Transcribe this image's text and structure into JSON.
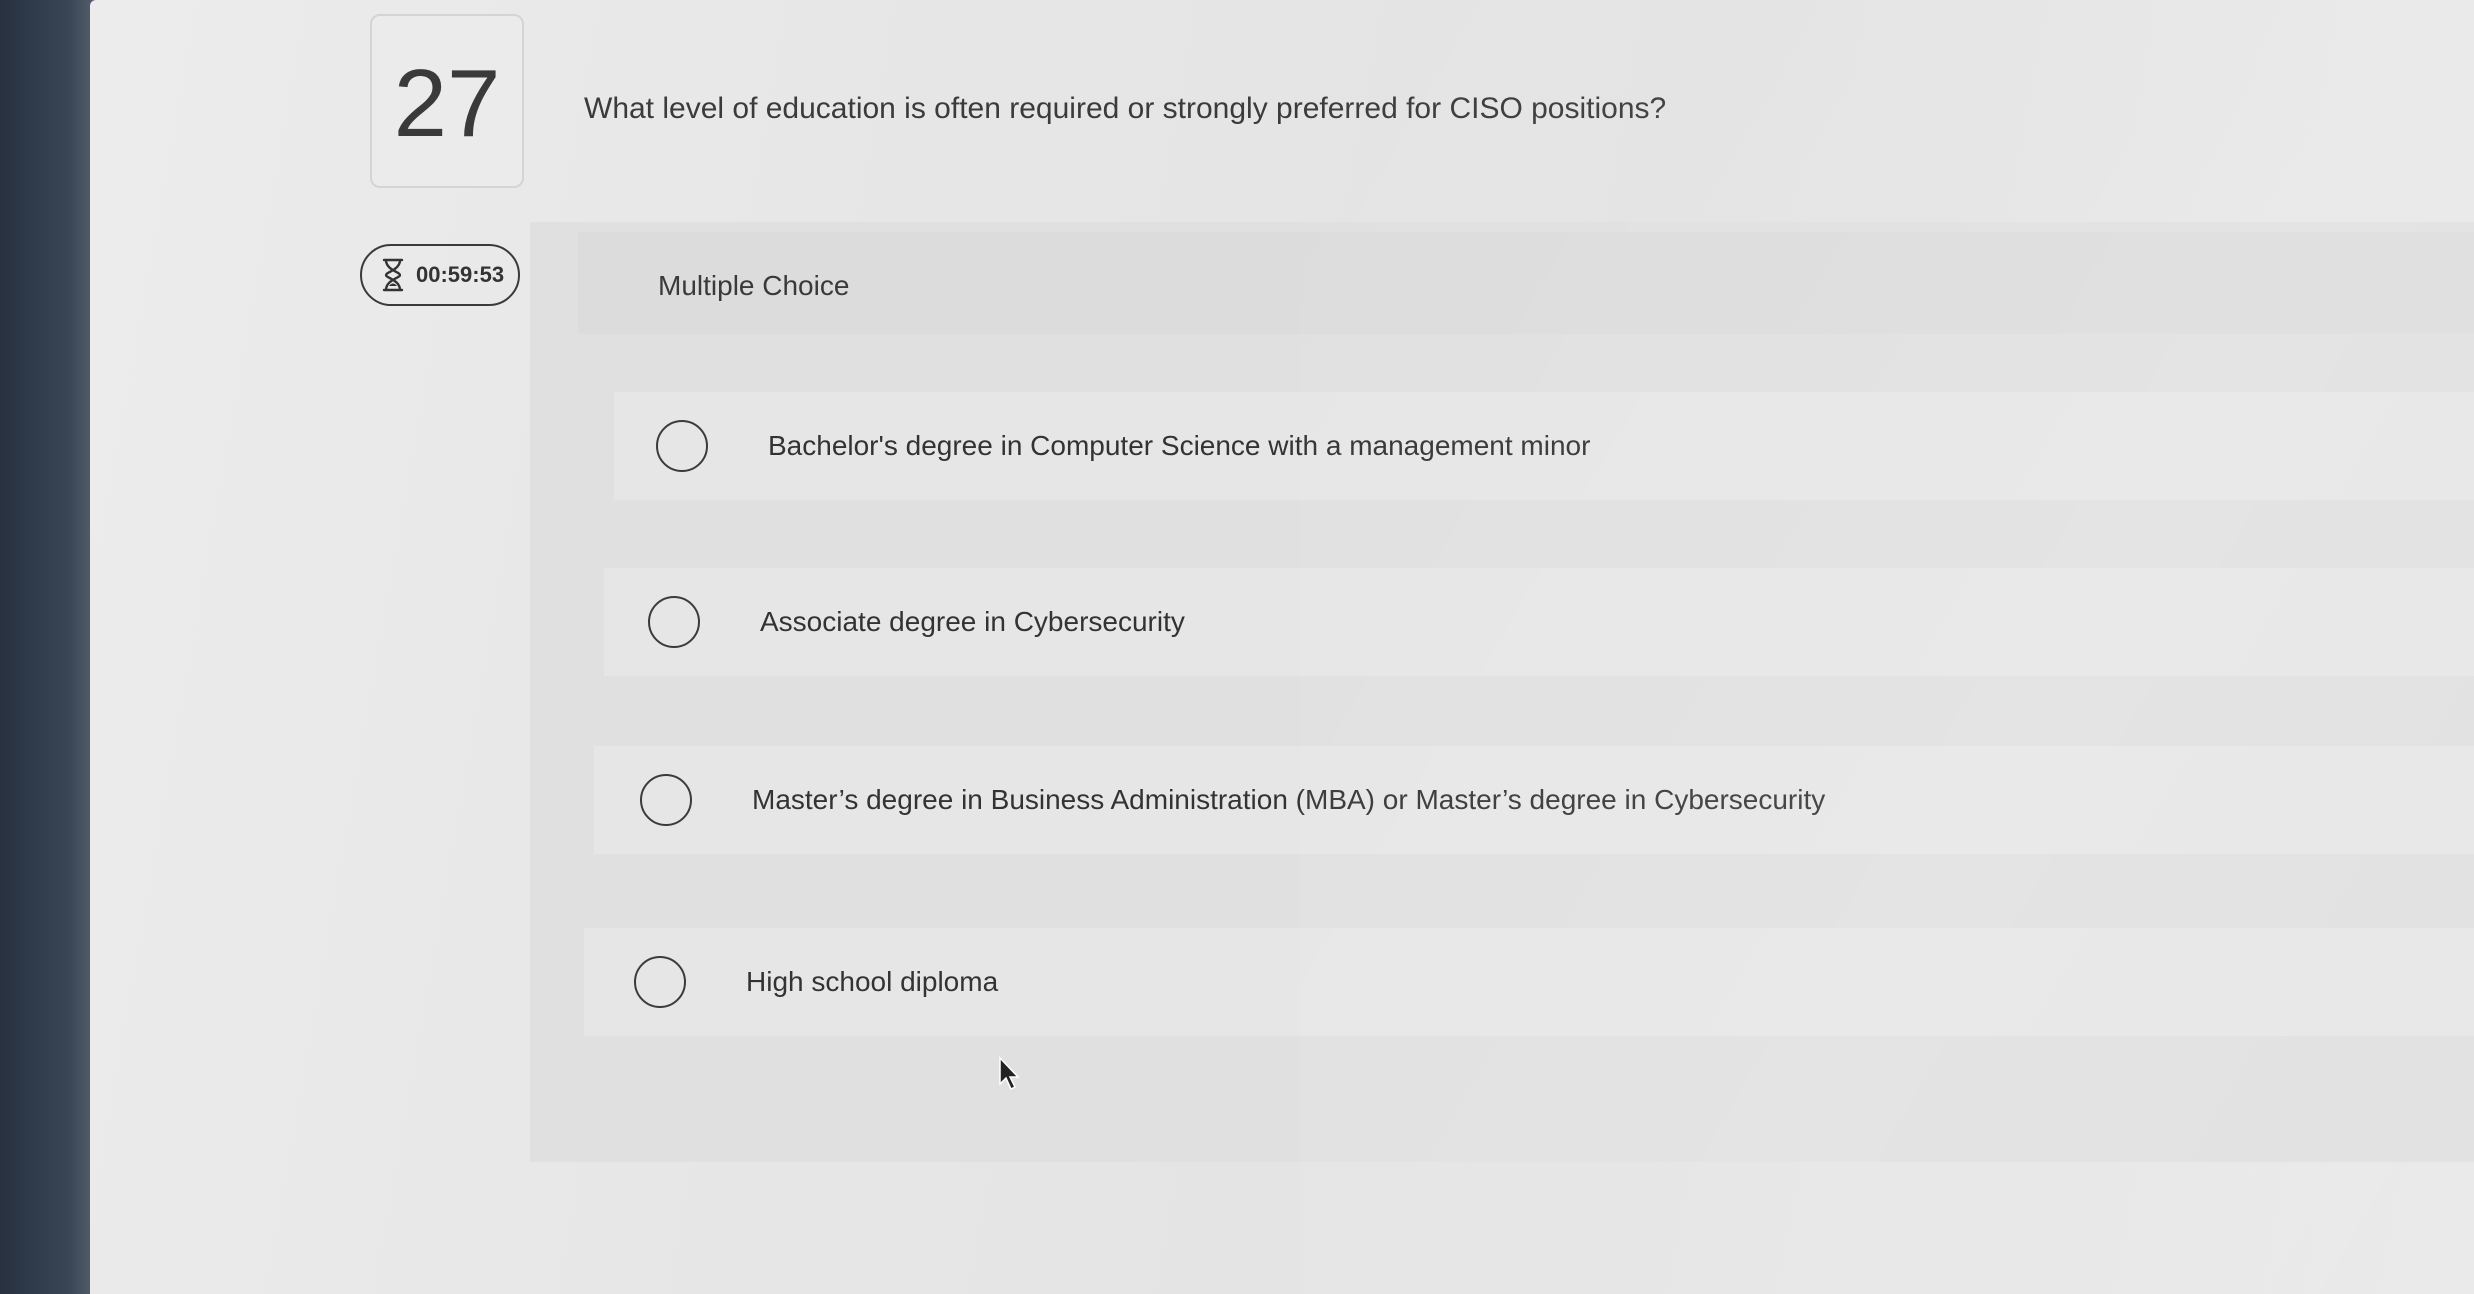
{
  "question": {
    "number": "27",
    "text": "What level of education is often required or strongly preferred for CISO positions?"
  },
  "timer": {
    "icon": "hourglass-icon",
    "time": "00:59:53"
  },
  "answer_panel": {
    "type_label": "Multiple Choice",
    "options": [
      {
        "label": "Bachelor's degree in Computer Science with a management minor",
        "selected": false
      },
      {
        "label": "Associate degree in Cybersecurity",
        "selected": false
      },
      {
        "label": "Master’s degree in Business Administration (MBA) or Master’s degree in Cybersecurity",
        "selected": false
      },
      {
        "label": "High school diploma",
        "selected": false
      }
    ]
  },
  "colors": {
    "text": "#3b3b3b",
    "panel": "#e0e0e0",
    "option_background": "#e6e6e6",
    "bezel": "#2f3946"
  }
}
